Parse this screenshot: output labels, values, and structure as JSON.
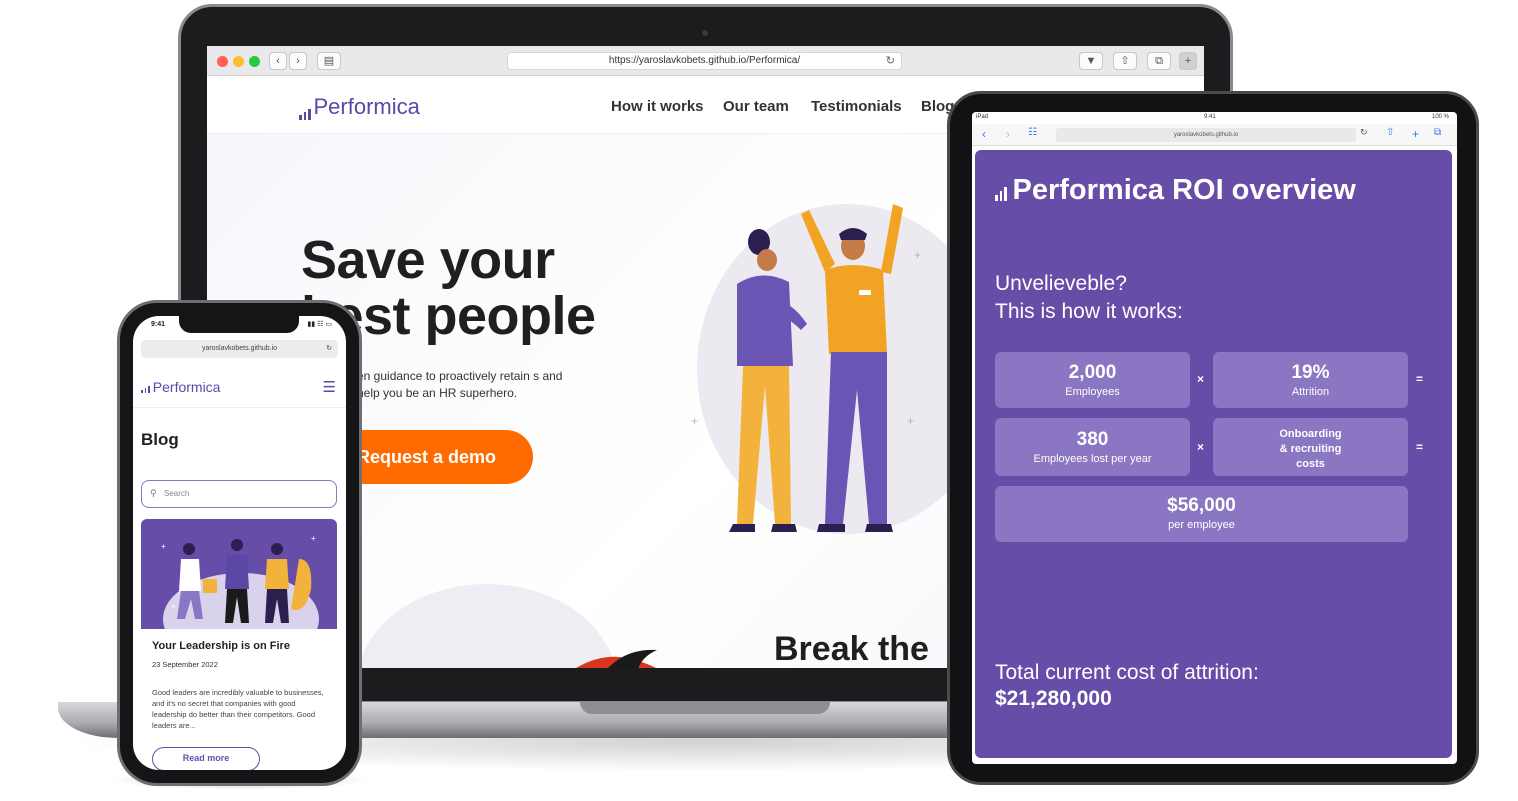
{
  "laptop": {
    "url": "https://yaroslavkobets.github.io/Performica/",
    "logo": "Performica",
    "nav": [
      "How it works",
      "Our team",
      "Testimonials",
      "Blog"
    ],
    "hero_title_line1": "Save your",
    "hero_title_line2": "best people",
    "hero_subtitle": "en guidance to proactively retain s and help you be an HR superhero.",
    "cta": "Request a demo",
    "section_title": "Break the"
  },
  "tablet": {
    "time": "9:41",
    "carrier": "iPad",
    "battery": "100 %",
    "url": "yaroslavkobets.github.io",
    "title": "Performica ROI overview",
    "question_line1": "Unvelieveble?",
    "question_line2": "This is how it works:",
    "employees_value": "2,000",
    "employees_label": "Employees",
    "attrition_value": "19%",
    "attrition_label": "Attrition",
    "lost_value": "380",
    "lost_label": "Employees lost per year",
    "onboarding_line1": "Onboarding",
    "onboarding_line2": "& recruiting",
    "onboarding_line3": "costs",
    "cost_value": "$56,000",
    "cost_label": "per employee",
    "op_times": "×",
    "op_equals": "=",
    "total_label": "Total current cost of attrition:",
    "total_value": "$21,280,000",
    "colors": {
      "panel": "#664ea8",
      "box": "#8a76c2"
    }
  },
  "phone": {
    "time": "9:41",
    "url": "yaroslavkobets.github.io",
    "logo": "Performica",
    "page_title": "Blog",
    "search_placeholder": "Search",
    "card_title": "Your Leadership is on Fire",
    "card_date": "23 September 2022",
    "card_text": "Good leaders are incredibly valuable to businesses, and it's no secret that companies with good leadership do better than their competitors. Good leaders are...",
    "read_more": "Read more"
  },
  "colors": {
    "brand": "#5b47a5",
    "cta": "#ff6b00"
  }
}
